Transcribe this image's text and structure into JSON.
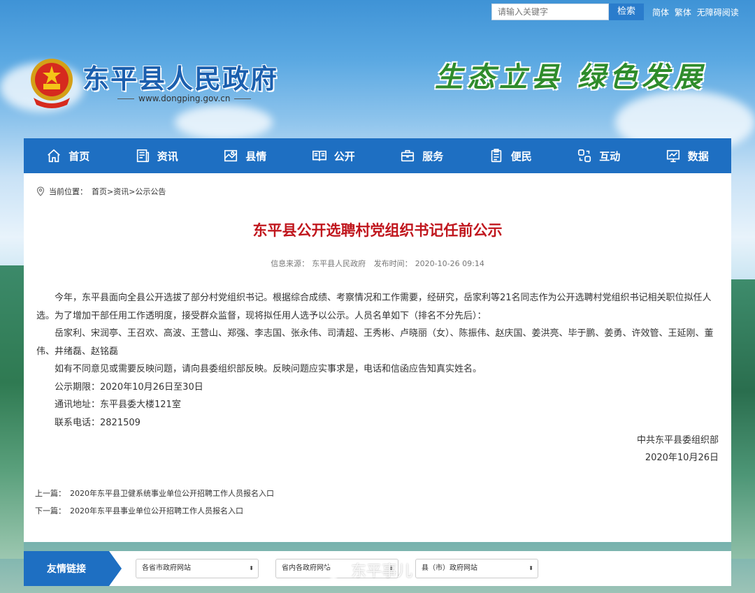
{
  "search": {
    "placeholder": "请输入关键字",
    "button": "检索"
  },
  "lang_links": [
    "简体",
    "繁体",
    "无障碍阅读"
  ],
  "header": {
    "title": "东平县人民政府",
    "url": "www.dongping.gov.cn",
    "slogan": "生态立县  绿色发展"
  },
  "nav": [
    {
      "label": "首页",
      "icon": "home-icon"
    },
    {
      "label": "资讯",
      "icon": "news-icon"
    },
    {
      "label": "县情",
      "icon": "map-icon"
    },
    {
      "label": "公开",
      "icon": "book-icon"
    },
    {
      "label": "服务",
      "icon": "briefcase-icon"
    },
    {
      "label": "便民",
      "icon": "clipboard-icon"
    },
    {
      "label": "互动",
      "icon": "interact-icon"
    },
    {
      "label": "数据",
      "icon": "monitor-icon"
    }
  ],
  "breadcrumb": {
    "label": "当前位置：",
    "path": "首页>资讯>公示公告"
  },
  "article": {
    "title": "东平县公开选聘村党组织书记任前公示",
    "source_label": "信息来源：",
    "source": "东平县人民政府",
    "time_label": "发布时间：",
    "time": "2020-10-26 09:14",
    "paragraphs": [
      "今年，东平县面向全县公开选拔了部分村党组织书记。根据综合成绩、考察情况和工作需要，经研究，岳家利等21名同志作为公开选聘村党组织书记相关职位拟任人选。为了增加干部任用工作透明度，接受群众监督，现将拟任用人选予以公示。人员名单如下（排名不分先后）：",
      "岳家利、宋润亭、王召欢、高波、王营山、郑强、李志国、张永伟、司清超、王秀彬、卢晓丽（女）、陈振伟、赵庆国、姜洪亮、毕于鹏、姜勇、许效管、王延刚、董伟、井绪磊、赵铭磊",
      "如有不同意见或需要反映问题，请向县委组织部反映。反映问题应实事求是，电话和信函应告知真实姓名。",
      "公示期限：2020年10月26日至30日",
      "通讯地址：东平县委大楼121室",
      "联系电话：2821509"
    ],
    "signer": "中共东平县委组织部",
    "sign_date": "2020年10月26日"
  },
  "prev": {
    "label": "上一篇：",
    "title": "2020年东平县卫健系统事业单位公开招聘工作人员报名入口"
  },
  "next": {
    "label": "下一篇：",
    "title": "2020年东平县事业单位公开招聘工作人员报名入口"
  },
  "footer": {
    "friend_label": "友情链接",
    "selects": [
      "各省市政府网站",
      "省内各政府网站",
      "县（市）政府网站"
    ]
  },
  "watermark": "东平事儿"
}
